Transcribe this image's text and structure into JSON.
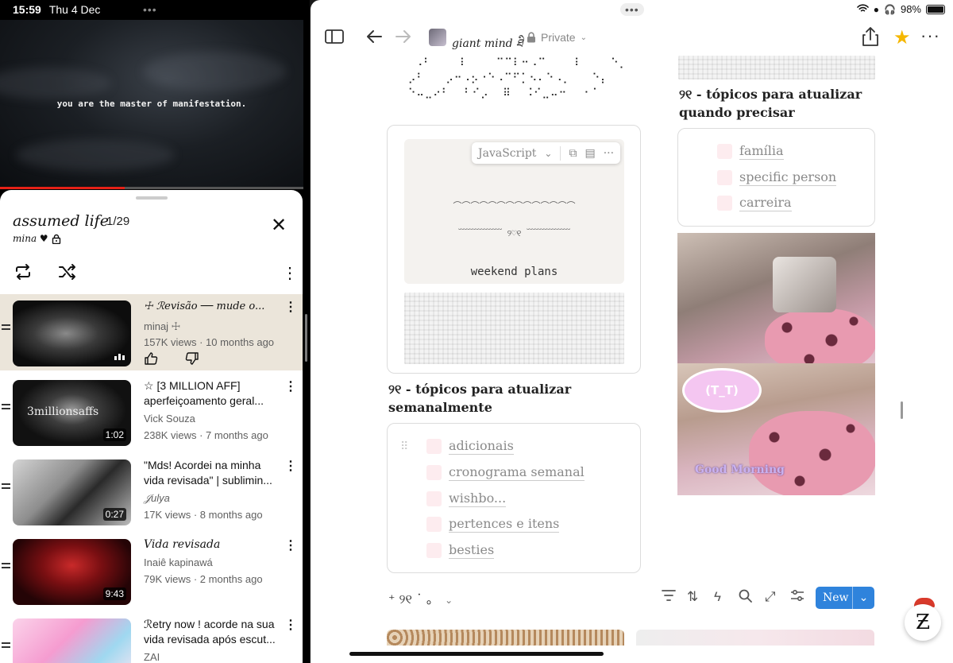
{
  "status": {
    "time": "15:59",
    "date": "Thu 4 Dec",
    "battery": "98%",
    "multitask_dots": "•••"
  },
  "youtube": {
    "video_caption": "you are the master of manifestation.",
    "progress": 0.41,
    "playlist": {
      "title": "assumed life",
      "position": "1/29",
      "owner": "mina ♥",
      "items": [
        {
          "title": "☩ ℛevisão ── mude o...",
          "channel": "minaj ☩",
          "meta": "157K views · 10 months ago",
          "duration": "",
          "thumb_color": "#0f0f0f",
          "active": true
        },
        {
          "title": "☆ [3 MILLION AFF] aperfeiçoamento geral...",
          "channel": "Vick Souza",
          "meta": "238K views · 7 months ago",
          "duration": "1:02",
          "thumb_color": "#1a1a1a",
          "active": false
        },
        {
          "title": "\"Mds! Acordei na minha vida revisada\" | sublimin...",
          "channel": "𝒥ulya",
          "meta": "17K views · 8 months ago",
          "duration": "0:27",
          "thumb_color": "#9a9a9a",
          "active": false
        },
        {
          "title": "Vida revisada",
          "channel": "Inaiê kapinawá",
          "meta": "79K views · 2 months ago",
          "duration": "9:43",
          "thumb_color": "#5a0f10",
          "active": false
        },
        {
          "title": "ℛetry now ! acorde na sua vida revisada após escut...",
          "channel": "ZAI",
          "meta": "",
          "duration": "",
          "thumb_color": "#f7c6e4",
          "active": false
        }
      ]
    }
  },
  "notion": {
    "workspace": "giant mind ཐི",
    "visibility": "Private",
    "braille_art": "  ⠠⠃    ⠇    ⠉⠉⠇⠒⠠⠉    ⠇    ⠑⡀\n ⡠⠃   ⡠⠒⠠⡢⠐⠑⠠⠉⠋⡁⠢⠄⠑⠠⡀   ⠑⡄\n ⠑⠤⣀⠔⠃  ⠃⠊⡠  ⠿  ⠨⠊⣀⠤⠒  ⠐⠈",
    "code_lang": "JavaScript",
    "code_lines": [
      "︵︵︵︵︵︵︵︵︵︵︵︵︵︵",
      "﹋﹋﹋﹋﹋ ୨♡୧ ﹋﹋﹋﹋﹋",
      "weekend plans",
      "﹋﹋﹋﹋﹋﹋﹋﹋﹋﹋﹋﹋﹋",
      "︶︶︶︶︶︶︶︶︶︶︶︶︶︶"
    ],
    "heading_weekly": "୨୧ - tópicos  para atualizar semanalmente",
    "weekly_items": [
      "adicionais",
      "cronograma semanal",
      "wishbo...",
      "pertences e itens",
      "besties"
    ],
    "heading_asneeded": "୨୧ - tópicos  para atualizar quando precisar",
    "asneeded_items": [
      "família",
      "specific person",
      "carreira"
    ],
    "photo_bubble": "(T_T)",
    "photo_text": "Good Morning",
    "db_title": "⁺ ୨୧ ˙ ｡",
    "new_label": "New",
    "fab_label": "Ƶ"
  }
}
